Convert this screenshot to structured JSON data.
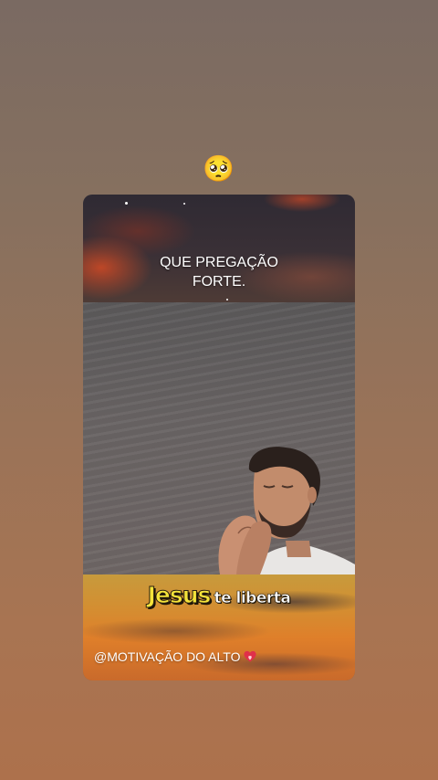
{
  "story": {
    "emoji": "🥺",
    "video": {
      "caption_top_line1": "QUE PREGAÇÃO",
      "caption_top_line2": "FORTE.",
      "highlight_word": "Jesus",
      "highlight_rest": "te liberta",
      "watermark": "@MOTIVAÇÃO DO ALTO",
      "watermark_icon": "heart-icon"
    }
  },
  "colors": {
    "highlight_yellow": "#f4e33a",
    "heart_red": "#e0304a"
  }
}
